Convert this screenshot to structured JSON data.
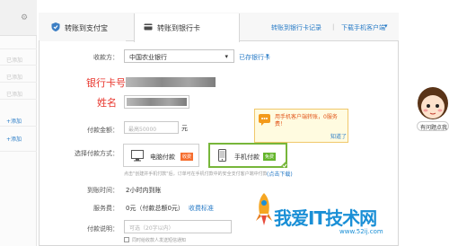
{
  "left_panel": {
    "items": [
      "已添加",
      "已添加",
      "已添加"
    ],
    "add_links": [
      "+添加",
      "+添加"
    ]
  },
  "tabs": [
    {
      "label": "转账到支付宝",
      "icon": "shield-icon",
      "active": false
    },
    {
      "label": "转账到银行卡",
      "icon": "card-icon",
      "active": true
    }
  ],
  "header_links": {
    "history": "转账到银行卡记录",
    "divider": "|",
    "download": "下载手机客户端"
  },
  "form": {
    "payee_label": "收款方：",
    "bank_select": "中国农业银行",
    "bank_saved_link": "已存银行卡",
    "card_number_label": "银行卡号",
    "name_label": "姓名",
    "amount_label": "付款金额：",
    "amount_placeholder": "最高50000",
    "amount_unit": "元",
    "method_label": "选择付款方式：",
    "method_pc": "电脑付款",
    "method_pc_tag": "收费",
    "method_mobile": "手机付款",
    "method_mobile_tag": "免费",
    "method_note": "点击\"创建并手机付款\"后，订单可在手机付款中的安全支付客户端中付款",
    "method_note_link": "(点击下载)",
    "arrival_label": "到账时间：",
    "arrival_value": "2小时内到账",
    "fee_label": "服务费：",
    "fee_value": "0元（付款总额0元）",
    "fee_link": "收费标准",
    "memo_label": "付款说明：",
    "memo_placeholder": "可选（20字以内）",
    "memo_checkbox": "同时给收款人发送短信通知"
  },
  "tooltip": {
    "text": "用手机客户端转账，0服务费！",
    "link": "知道了"
  },
  "right_panel": {
    "bubble_text": "有问题点我"
  },
  "watermark": {
    "text": "我爱IT技术网",
    "url": "www.52ij.com"
  },
  "colors": {
    "accent": "#2a7cc7",
    "red_label": "#e8362d",
    "orange_tag": "#f66e2f",
    "green_tag": "#64b52c",
    "watermark": "#1a8fd6"
  }
}
